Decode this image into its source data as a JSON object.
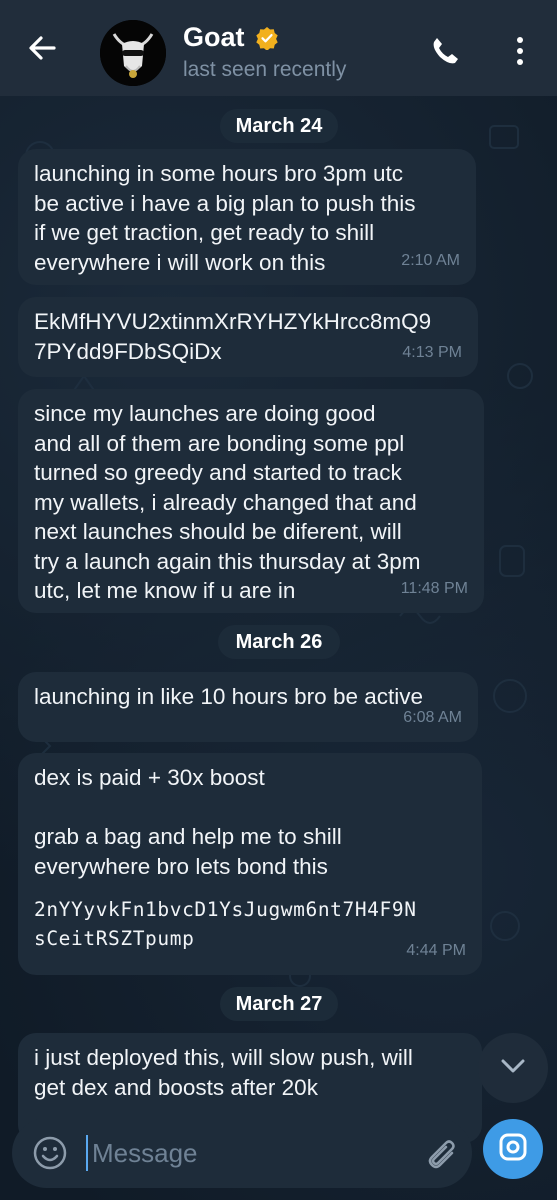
{
  "header": {
    "name": "Goat",
    "status": "last seen recently"
  },
  "messages": [
    {
      "type": "date",
      "label": "March 24"
    },
    {
      "type": "msg",
      "text": "launching in some hours bro 3pm utc\nbe active i have a big plan to push this\nif we get traction, get ready to shill\neverywhere i will work on this",
      "time": "2:10 AM"
    },
    {
      "type": "msg",
      "text": "EkMfHYVU2xtinmXrRYHZYkHrcc8mQ9\n7PYdd9FDbSQiDx",
      "time": "4:13 PM"
    },
    {
      "type": "msg",
      "text": "since my launches are doing good\nand all of them are bonding some ppl\nturned so greedy and started to track\nmy wallets, i already changed that and\nnext launches should be diferent, will\ntry a launch again this thursday at 3pm\nutc, let me know if u are in",
      "time": "11:48 PM"
    },
    {
      "type": "date",
      "label": "March 26"
    },
    {
      "type": "msg",
      "text": "launching in like 10 hours bro be active",
      "time": "6:08 AM"
    },
    {
      "type": "msg",
      "text": "dex is paid + 30x boost\n\ngrab a bag and help me to shill\neverywhere bro lets bond this",
      "code": "2nYYyvkFn1bvcD1YsJugwm6nt7H4F9N\nsCeitRSZTpump",
      "time": "4:44 PM"
    },
    {
      "type": "date",
      "label": "March 27"
    },
    {
      "type": "msg",
      "text": "i just deployed this, will slow push, will\nget dex and boosts after 20k"
    }
  ],
  "input": {
    "placeholder": "Message"
  },
  "colors": {
    "header_bg": "#212d3b",
    "bubble_bg": "#1e2c3a",
    "accent": "#3e9be6",
    "verified": "#f2b01e"
  }
}
